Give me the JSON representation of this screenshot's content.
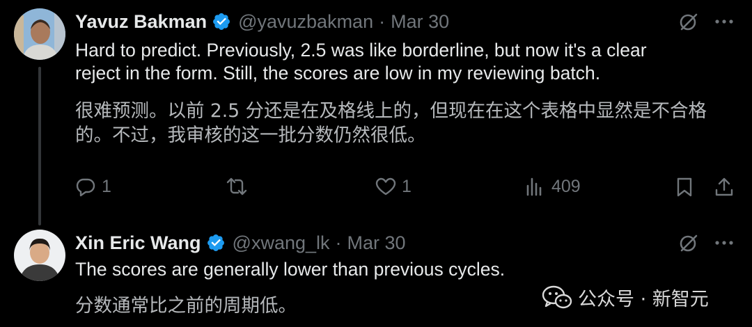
{
  "tweets": [
    {
      "name": "Yavuz Bakman",
      "handle": "@yavuzbakman",
      "separator": "·",
      "date": "Mar 30",
      "text_line1": "Hard to predict. Previously, 2.5 was like borderline, but now it's a clear",
      "text_line2": "reject in the form. Still, the scores are low in my reviewing batch.",
      "translation_line1": "很难预测。以前 2.5 分还是在及格线上的，但现在在这个表格中显然是不合格",
      "translation_line2": "的。不过，我审核的这一批分数仍然很低。",
      "replies": "1",
      "retweets": "",
      "likes": "1",
      "views": "409"
    },
    {
      "name": "Xin Eric Wang",
      "handle": "@xwang_lk",
      "separator": "·",
      "date": "Mar 30",
      "text_line1": "The scores are generally lower than previous cycles.",
      "translation_line1": "分数通常比之前的周期低。"
    }
  ],
  "watermark": {
    "text": "公众号 · 新智元"
  },
  "colors": {
    "background": "#000000",
    "text": "#e7e9ea",
    "muted": "#71767b",
    "verified": "#1d9bf0"
  },
  "icons": [
    "verified-badge-icon",
    "grok-icon",
    "more-icon",
    "reply-icon",
    "retweet-icon",
    "like-icon",
    "views-icon",
    "bookmark-icon",
    "share-icon",
    "wechat-icon"
  ]
}
